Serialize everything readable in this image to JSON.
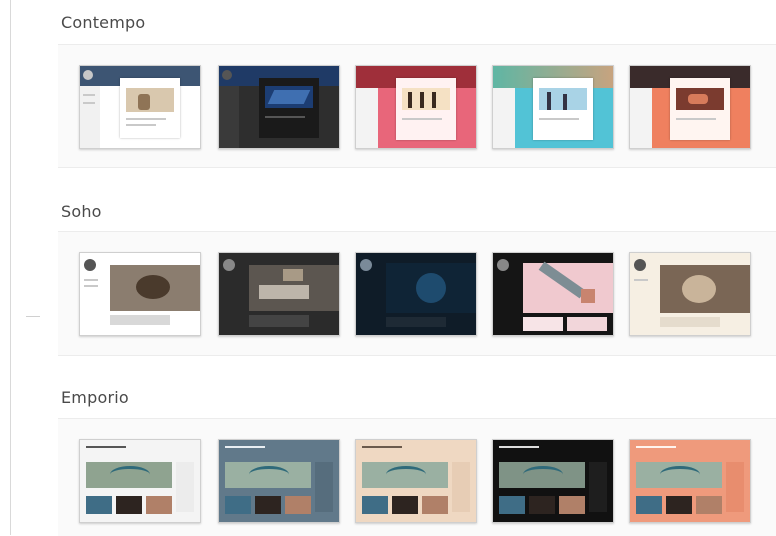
{
  "sections": [
    {
      "title": "Contempo",
      "themes": [
        {
          "variant": "light",
          "accent": "#3d5573"
        },
        {
          "variant": "dark",
          "accent": "#1f3a66"
        },
        {
          "variant": "rose",
          "accent": "#e8667a"
        },
        {
          "variant": "aqua",
          "accent": "#52c3d6"
        },
        {
          "variant": "coral",
          "accent": "#ef805f"
        }
      ]
    },
    {
      "title": "Soho",
      "themes": [
        {
          "variant": "light",
          "accent": "#6b5b4a"
        },
        {
          "variant": "dark",
          "accent": "#2b2b2b"
        },
        {
          "variant": "midnight",
          "accent": "#0f2436"
        },
        {
          "variant": "dark-pink",
          "accent": "#f0c9cf"
        },
        {
          "variant": "cream",
          "accent": "#f6efe3"
        }
      ]
    },
    {
      "title": "Emporio",
      "themes": [
        {
          "variant": "light",
          "accent": "#f4f4f4"
        },
        {
          "variant": "slate",
          "accent": "#61798a"
        },
        {
          "variant": "peach",
          "accent": "#efd8c2"
        },
        {
          "variant": "dark",
          "accent": "#111111"
        },
        {
          "variant": "salmon",
          "accent": "#ef9a7c"
        }
      ]
    }
  ]
}
